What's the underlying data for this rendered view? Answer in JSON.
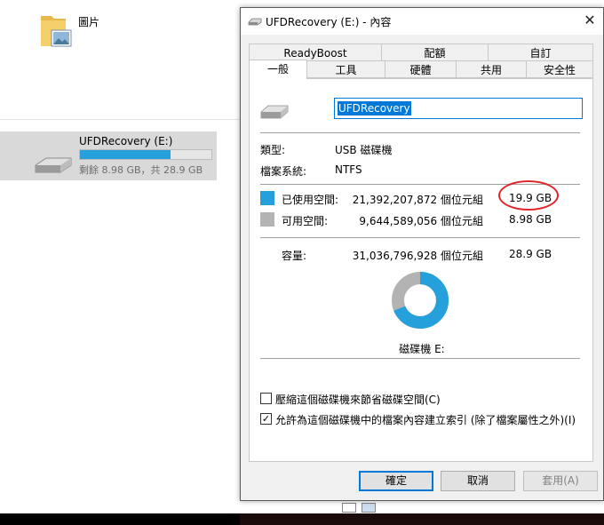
{
  "explorer": {
    "folder_label": "圖片",
    "drive_name": "UFDRecovery (E:)",
    "drive_free_text": "剩餘 8.98 GB，共 28.9 GB",
    "drive_used_fraction": 0.69
  },
  "dialog": {
    "title": "UFDRecovery (E:) - 內容",
    "close_glyph": "✕",
    "tabs_row1": [
      "ReadyBoost",
      "配額",
      "自訂"
    ],
    "tabs_row2": [
      "一般",
      "工具",
      "硬體",
      "共用",
      "安全性"
    ],
    "active_tab": "一般",
    "volume_name": "UFDRecovery",
    "type_label": "類型:",
    "type_value": "USB 磁碟機",
    "fs_label": "檔案系統:",
    "fs_value": "NTFS",
    "used_label": "已使用空間:",
    "used_bytes": "21,392,207,872 個位元組",
    "used_size": "19.9 GB",
    "free_label": "可用空間:",
    "free_bytes": "9,644,589,056 個位元組",
    "free_size": "8.98 GB",
    "capacity_label": "容量:",
    "capacity_bytes": "31,036,796,928 個位元組",
    "capacity_size": "28.9 GB",
    "drive_caption": "磁碟機 E:",
    "used_fraction": 0.689,
    "used_color": "#26a0da",
    "free_color": "#b3b3b3",
    "compress_label": "壓縮這個磁碟機來節省磁碟空間(C)",
    "compress_checked": false,
    "index_label": "允許為這個磁碟機中的檔案內容建立索引 (除了檔案屬性之外)(I)",
    "index_checked": true,
    "ok_label": "確定",
    "cancel_label": "取消",
    "apply_label": "套用(A)"
  }
}
